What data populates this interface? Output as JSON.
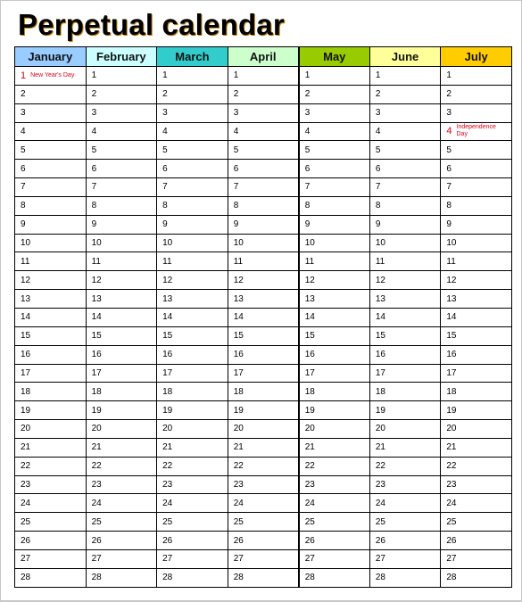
{
  "title": "Perpetual calendar",
  "months": [
    {
      "name": "January",
      "color": "#99ccff"
    },
    {
      "name": "February",
      "color": "#ccffff"
    },
    {
      "name": "March",
      "color": "#33cccc"
    },
    {
      "name": "April",
      "color": "#ccffcc"
    },
    {
      "name": "May",
      "color": "#99cc00"
    },
    {
      "name": "June",
      "color": "#ffff99"
    },
    {
      "name": "July",
      "color": "#ffcc00"
    }
  ],
  "days": [
    "1",
    "2",
    "3",
    "4",
    "5",
    "6",
    "7",
    "8",
    "9",
    "10",
    "11",
    "12",
    "13",
    "14",
    "15",
    "16",
    "17",
    "18",
    "19",
    "20",
    "21",
    "22",
    "23",
    "24",
    "25",
    "26",
    "27",
    "28"
  ],
  "holidays": [
    {
      "month_index": 0,
      "day": "1",
      "name": "New Year's Day",
      "color": "#e0001a"
    },
    {
      "month_index": 6,
      "day": "4",
      "name": "Independence Day",
      "color": "#e0001a"
    }
  ]
}
